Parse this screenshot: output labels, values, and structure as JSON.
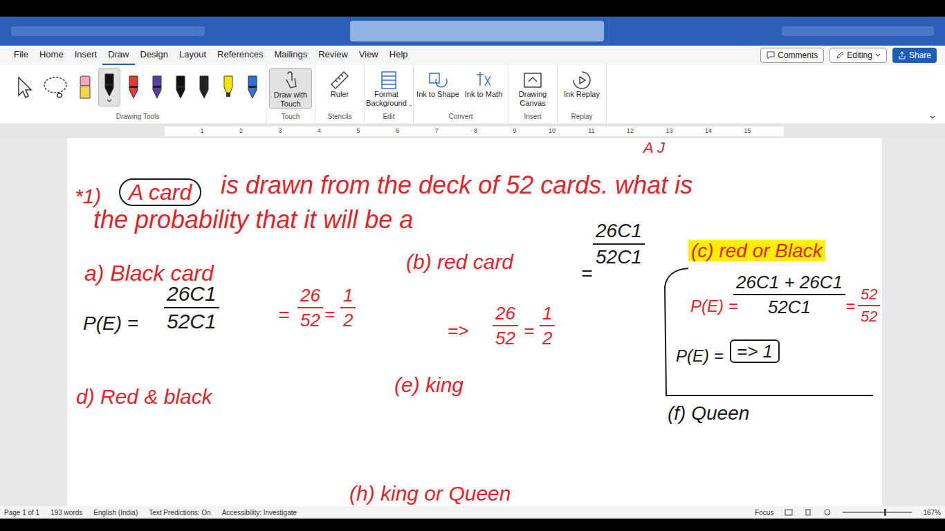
{
  "menu_tabs": [
    {
      "label": "File",
      "selected": false
    },
    {
      "label": "Home",
      "selected": false
    },
    {
      "label": "Insert",
      "selected": false
    },
    {
      "label": "Draw",
      "selected": true
    },
    {
      "label": "Design",
      "selected": false
    },
    {
      "label": "Layout",
      "selected": false
    },
    {
      "label": "References",
      "selected": false
    },
    {
      "label": "Mailings",
      "selected": false
    },
    {
      "label": "Review",
      "selected": false
    },
    {
      "label": "View",
      "selected": false
    },
    {
      "label": "Help",
      "selected": false
    }
  ],
  "header_buttons": {
    "comments": "Comments",
    "editing": "Editing",
    "share": "Share"
  },
  "pens": [
    {
      "kind": "select",
      "selected": false,
      "color": "#333333"
    },
    {
      "kind": "lasso",
      "selected": false,
      "color": "#333333"
    },
    {
      "kind": "eraser",
      "selected": false,
      "color": "#f4a6c0"
    },
    {
      "kind": "pen",
      "selected": true,
      "color": "#111111"
    },
    {
      "kind": "pen",
      "selected": false,
      "color": "#e53935"
    },
    {
      "kind": "pen",
      "selected": false,
      "color": "#5b3fa0"
    },
    {
      "kind": "pen",
      "selected": false,
      "color": "#111111"
    },
    {
      "kind": "pen",
      "selected": false,
      "color": "#222222"
    },
    {
      "kind": "highlighter",
      "selected": false,
      "color": "#f5e400"
    },
    {
      "kind": "pen",
      "selected": false,
      "color": "#2f6fd8"
    }
  ],
  "ribbon_groups": [
    {
      "label": "Drawing Tools",
      "buttons": []
    },
    {
      "label": "Touch",
      "buttons": [
        {
          "label": "Draw with Touch",
          "selected": true,
          "dropdown": false
        }
      ]
    },
    {
      "label": "Stencils",
      "buttons": [
        {
          "label": "Ruler",
          "selected": false,
          "dropdown": false
        }
      ]
    },
    {
      "label": "Edit",
      "buttons": [
        {
          "label": "Format Background",
          "selected": false,
          "dropdown": true
        }
      ]
    },
    {
      "label": "Convert",
      "buttons": [
        {
          "label": "Ink to Shape",
          "selected": false,
          "dropdown": false
        },
        {
          "label": "Ink to Math",
          "selected": false,
          "dropdown": false
        }
      ]
    },
    {
      "label": "Insert",
      "buttons": [
        {
          "label": "Drawing Canvas",
          "selected": false,
          "dropdown": false
        }
      ]
    },
    {
      "label": "Replay",
      "buttons": [
        {
          "label": "Ink Replay",
          "selected": false,
          "dropdown": false
        }
      ]
    }
  ],
  "ruler_ticks": [
    "1",
    "2",
    "3",
    "4",
    "5",
    "6",
    "7",
    "8",
    "9",
    "10",
    "11",
    "12",
    "13",
    "14",
    "15"
  ],
  "ink": [
    {
      "kind": "text",
      "text": "A J",
      "color": "#e0242a",
      "circled": false,
      "highlighted": false,
      "boxed": false
    },
    {
      "kind": "text",
      "text": "*1)",
      "color": "#e0242a",
      "circled": false,
      "highlighted": false,
      "boxed": false
    },
    {
      "kind": "text",
      "text": "A card",
      "color": "#e0242a",
      "circled": true,
      "highlighted": false,
      "boxed": false
    },
    {
      "kind": "text",
      "text": "is drawn from the deck of 52 cards. what is",
      "color": "#e0242a",
      "circled": false,
      "highlighted": false,
      "boxed": false
    },
    {
      "kind": "text",
      "text": "the probability that it will be a",
      "color": "#e0242a",
      "circled": false,
      "highlighted": false,
      "boxed": false
    },
    {
      "kind": "text",
      "text": "a) Black card",
      "color": "#e0242a",
      "circled": false,
      "highlighted": false,
      "boxed": false
    },
    {
      "kind": "text",
      "text": "P(E) =",
      "color": "#1a1a1a",
      "circled": false,
      "highlighted": false,
      "boxed": false
    },
    {
      "kind": "fraction",
      "numerator": "26C1",
      "denominator": "52C1",
      "color": "#1a1a1a"
    },
    {
      "kind": "text",
      "text": "=",
      "color": "#e0242a",
      "circled": false,
      "highlighted": false,
      "boxed": false
    },
    {
      "kind": "fraction",
      "numerator": "26",
      "denominator": "52",
      "color": "#e0242a"
    },
    {
      "kind": "text",
      "text": "=",
      "color": "#e0242a",
      "circled": false,
      "highlighted": false,
      "boxed": false
    },
    {
      "kind": "fraction",
      "numerator": "1",
      "denominator": "2",
      "color": "#e0242a"
    },
    {
      "kind": "text",
      "text": "(b) red card",
      "color": "#e0242a",
      "circled": false,
      "highlighted": false,
      "boxed": false
    },
    {
      "kind": "text",
      "text": "=",
      "color": "#1a1a1a",
      "circled": false,
      "highlighted": false,
      "boxed": false
    },
    {
      "kind": "fraction",
      "numerator": "26C1",
      "denominator": "52C1",
      "color": "#1a1a1a"
    },
    {
      "kind": "text",
      "text": "=>",
      "color": "#e0242a",
      "circled": false,
      "highlighted": false,
      "boxed": false
    },
    {
      "kind": "fraction",
      "numerator": "26",
      "denominator": "52",
      "color": "#e0242a"
    },
    {
      "kind": "text",
      "text": "=",
      "color": "#e0242a",
      "circled": false,
      "highlighted": false,
      "boxed": false
    },
    {
      "kind": "fraction",
      "numerator": "1",
      "denominator": "2",
      "color": "#e0242a"
    },
    {
      "kind": "text",
      "text": "(c) red or Black",
      "color": "#e0242a",
      "circled": false,
      "highlighted": true,
      "boxed": false
    },
    {
      "kind": "text",
      "text": "P(E) =",
      "color": "#e0242a",
      "circled": false,
      "highlighted": false,
      "boxed": false
    },
    {
      "kind": "fraction",
      "numerator": "26C1 + 26C1",
      "denominator": "52C1",
      "color": "#1a1a1a"
    },
    {
      "kind": "text",
      "text": "=",
      "color": "#e0242a",
      "circled": false,
      "highlighted": false,
      "boxed": false
    },
    {
      "kind": "fraction",
      "numerator": "52",
      "denominator": "52",
      "color": "#e0242a"
    },
    {
      "kind": "text",
      "text": "P(E) =",
      "color": "#1a1a1a",
      "circled": false,
      "highlighted": false,
      "boxed": false
    },
    {
      "kind": "text",
      "text": "=> 1",
      "color": "#1a1a1a",
      "circled": false,
      "highlighted": false,
      "boxed": true
    },
    {
      "kind": "text",
      "text": "d) Red & black",
      "color": "#e0242a",
      "circled": false,
      "highlighted": false,
      "boxed": false
    },
    {
      "kind": "text",
      "text": "(e) king",
      "color": "#e0242a",
      "circled": false,
      "highlighted": false,
      "boxed": false
    },
    {
      "kind": "text",
      "text": "(f) Queen",
      "color": "#1a1a1a",
      "circled": false,
      "highlighted": false,
      "boxed": false
    },
    {
      "kind": "text",
      "text": "(h) king or Queen",
      "color": "#e0242a",
      "circled": false,
      "highlighted": false,
      "boxed": false
    }
  ],
  "status_bar": {
    "page": "Page 1 of 1",
    "words": "193 words",
    "language": "English (India)",
    "predictions": "Text Predictions: On",
    "accessibility": "Accessibility: Investigate",
    "focus": "Focus",
    "zoom": "167%"
  }
}
